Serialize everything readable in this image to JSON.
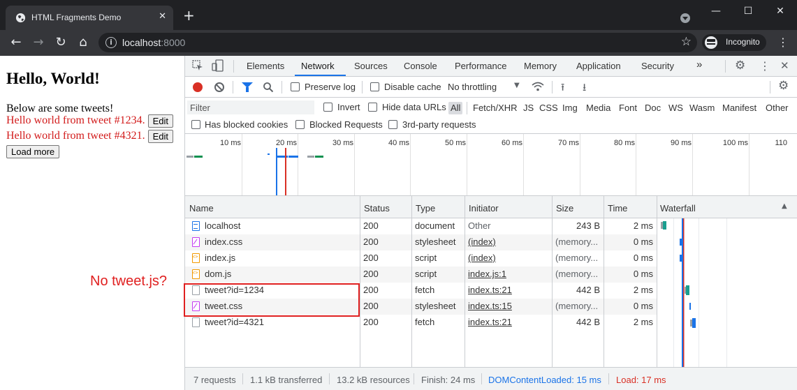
{
  "browser": {
    "tab_title": "HTML Fragments Demo",
    "tab_close": "✕",
    "new_tab": "+",
    "url_host": "localhost",
    "url_port": ":8000",
    "profile_label": "Incognito",
    "window_min": "—",
    "window_max": "☐",
    "window_close": "✕"
  },
  "page": {
    "heading": "Hello, World!",
    "intro": "Below are some tweets!",
    "tweets": [
      {
        "text": "Hello world from tweet #1234.",
        "button": "Edit"
      },
      {
        "text": "Hello world from tweet #4321.",
        "button": "Edit"
      }
    ],
    "load_more": "Load more"
  },
  "devtools": {
    "tabs": [
      "Elements",
      "Network",
      "Sources",
      "Console",
      "Performance",
      "Memory",
      "Application",
      "Security"
    ],
    "active_tab": "Network",
    "more_tabs": "»",
    "toolbar": {
      "preserve_log": "Preserve log",
      "disable_cache": "Disable cache",
      "throttling": "No throttling"
    },
    "filter": {
      "placeholder": "Filter",
      "invert": "Invert",
      "hide_data_urls": "Hide data URLs",
      "types": [
        "All",
        "Fetch/XHR",
        "JS",
        "CSS",
        "Img",
        "Media",
        "Font",
        "Doc",
        "WS",
        "Wasm",
        "Manifest",
        "Other"
      ],
      "active_type": "All",
      "has_blocked_cookies": "Has blocked cookies",
      "blocked_requests": "Blocked Requests",
      "third_party": "3rd-party requests"
    },
    "overview_ticks": [
      "10 ms",
      "20 ms",
      "30 ms",
      "40 ms",
      "50 ms",
      "60 ms",
      "70 ms",
      "80 ms",
      "90 ms",
      "100 ms",
      "110"
    ],
    "columns": [
      "Name",
      "Status",
      "Type",
      "Initiator",
      "Size",
      "Time",
      "Waterfall"
    ],
    "requests": [
      {
        "name": "localhost",
        "icon": "document-icon",
        "status": "200",
        "type": "document",
        "initiator": "Other",
        "size": "243 B",
        "time": "2 ms"
      },
      {
        "name": "index.css",
        "icon": "stylesheet-icon",
        "status": "200",
        "type": "stylesheet",
        "initiator": "(index)",
        "size": "(memory...",
        "time": "0 ms"
      },
      {
        "name": "index.js",
        "icon": "script-icon",
        "status": "200",
        "type": "script",
        "initiator": "(index)",
        "size": "(memory...",
        "time": "0 ms"
      },
      {
        "name": "dom.js",
        "icon": "script-icon",
        "status": "200",
        "type": "script",
        "initiator": "index.js:1",
        "size": "(memory...",
        "time": "0 ms"
      },
      {
        "name": "tweet?id=1234",
        "icon": "fetch-icon",
        "status": "200",
        "type": "fetch",
        "initiator": "index.ts:21",
        "size": "442 B",
        "time": "2 ms"
      },
      {
        "name": "tweet.css",
        "icon": "stylesheet-icon",
        "status": "200",
        "type": "stylesheet",
        "initiator": "index.ts:15",
        "size": "(memory...",
        "time": "0 ms"
      },
      {
        "name": "tweet?id=4321",
        "icon": "fetch-icon",
        "status": "200",
        "type": "fetch",
        "initiator": "index.ts:21",
        "size": "442 B",
        "time": "2 ms"
      }
    ],
    "status": {
      "requests": "7 requests",
      "transferred": "1.1 kB transferred",
      "resources": "13.2 kB resources",
      "finish": "Finish: 24 ms",
      "dcl": "DOMContentLoaded: 15 ms",
      "load": "Load: 17 ms"
    }
  },
  "annotation": {
    "text": "No tweet.js?"
  },
  "colors": {
    "accent": "#1a73e8",
    "tweet_text": "#d21a1a",
    "annotation": "#e02020",
    "record": "#d93025"
  }
}
